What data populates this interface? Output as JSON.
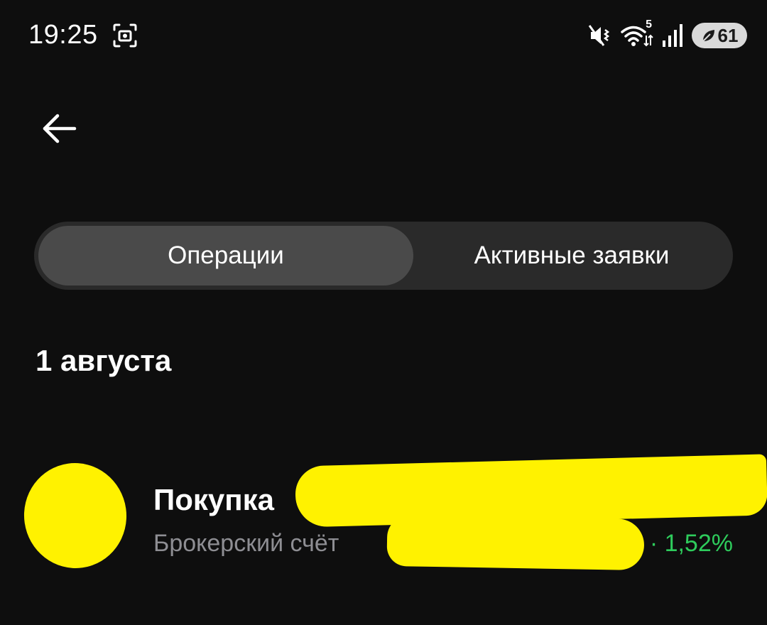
{
  "status_bar": {
    "time": "19:25",
    "battery_level": "61",
    "wifi_badge": "5"
  },
  "tabs": [
    {
      "label": "Операции",
      "active": true
    },
    {
      "label": "Активные заявки",
      "active": false
    }
  ],
  "date_header": "1 августа",
  "operations": [
    {
      "title": "Покупка",
      "subtitle": "Брокерский счёт",
      "percent": "· 1,52%"
    }
  ],
  "colors": {
    "background": "#0e0e0e",
    "segment_track": "#2a2a2a",
    "segment_active": "#4a4a4a",
    "positive": "#2ecc5c",
    "secondary_text": "#8e8e93",
    "redaction": "#fff200"
  },
  "icons": {
    "back": "arrow-left-icon",
    "screenshot": "screenshot-icon",
    "mute": "vibrate-mute-icon",
    "wifi": "wifi-icon",
    "signal": "cellular-signal-icon",
    "battery": "battery-icon"
  }
}
